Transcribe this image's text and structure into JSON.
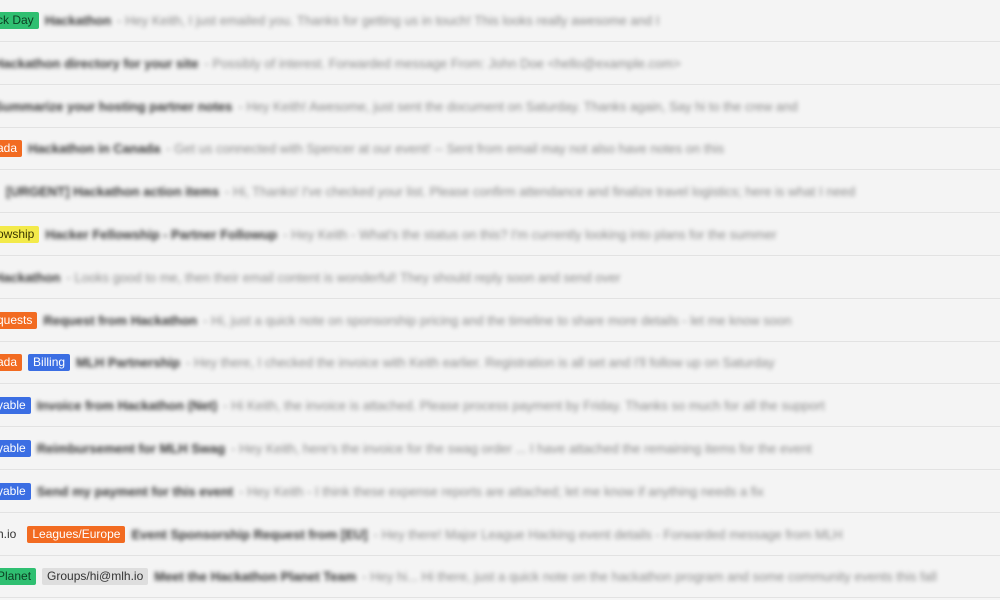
{
  "inbox": {
    "rows": [
      {
        "labels": [
          {
            "text": "ck Day",
            "color": "#2fbf71"
          }
        ],
        "subject": "Hackathon",
        "snippet": "- Hey Keith, I just emailed you. Thanks for getting us in touch! This looks really awesome and I"
      },
      {
        "labels": [],
        "subject": "Hackathon directory for your site",
        "snippet": "- Possibly of interest. Forwarded message From: John Doe <hello@example.com>"
      },
      {
        "labels": [],
        "subject": "Summarize your hosting partner notes",
        "snippet": "- Hey Keith! Awesome, just sent the document on Saturday. Thanks again, Say hi to the crew and"
      },
      {
        "labels": [
          {
            "text": "ada",
            "color": "#f26b21"
          }
        ],
        "subject": "Hackathon in Canada",
        "snippet": "- Get us connected with Spencer at our event! -- Sent from email may not also have notes on this"
      },
      {
        "labels": [
          {
            "text": "",
            "color": "#2fbf71"
          }
        ],
        "subject": "[URGENT] Hackathon action items",
        "snippet": "- Hi, Thanks! I've checked your list. Please confirm attendance and finalize travel logistics; here is what I need"
      },
      {
        "labels": [
          {
            "text": "owship",
            "color": "#f3ea4a"
          }
        ],
        "subject": "Hacker Fellowship - Partner Followup",
        "snippet": "- Hey Keith - What's the status on this? I'm currently looking into plans for the summer"
      },
      {
        "labels": [],
        "subject": "Hackathon",
        "snippet": "- Looks good to me, then their email content is wonderful! They should reply soon and send over"
      },
      {
        "labels": [
          {
            "text": "quests",
            "color": "#f26b21"
          }
        ],
        "subject": "Request from Hackathon",
        "snippet": "- Hi, just a quick note on sponsorship pricing and the timeline to share more details - let me know soon"
      },
      {
        "labels": [
          {
            "text": "ada",
            "color": "#f26b21"
          },
          {
            "text": "Billing",
            "color": "#3b6ee3"
          }
        ],
        "subject": "MLH Partnership",
        "snippet": "- Hey there, I checked the invoice with Keith earlier. Registration is all set and I'll follow up on Saturday"
      },
      {
        "labels": [
          {
            "text": "yable",
            "color": "#3b6ee3"
          }
        ],
        "subject": "Invoice from Hackathon (Net)",
        "snippet": "- Hi Keith, the invoice is attached. Please process payment by Friday. Thanks so much for all the support"
      },
      {
        "labels": [
          {
            "text": "yable",
            "color": "#3b6ee3"
          }
        ],
        "subject": "Reimbursement for MLH Swag",
        "snippet": "- Hey Keith, here's the invoice for the swag order ... I have attached the remaining items for the event"
      },
      {
        "labels": [
          {
            "text": "yable",
            "color": "#3b6ee3"
          }
        ],
        "subject": "Send my payment for this event",
        "snippet": "- Hey Keith - I think these expense reports are attached; let me know if anything needs a fix"
      },
      {
        "labels": [
          {
            "text": "h.io",
            "color": "#f4f4f4"
          },
          {
            "text": "Leagues/Europe",
            "color": "#f26b21"
          }
        ],
        "subject": "Event Sponsorship Request from [EU]",
        "snippet": "- Hey there! Major League Hacking event details - Forwarded message from MLH"
      },
      {
        "labels": [
          {
            "text": "Planet",
            "color": "#2fbf71"
          },
          {
            "text": "Groups/hi@mlh.io",
            "color": "#dedede"
          }
        ],
        "subject": "Meet the Hackathon Planet Team",
        "snippet": "- Hey hi... Hi there, just a quick note on the hackathon program and some community events this fall"
      }
    ]
  }
}
